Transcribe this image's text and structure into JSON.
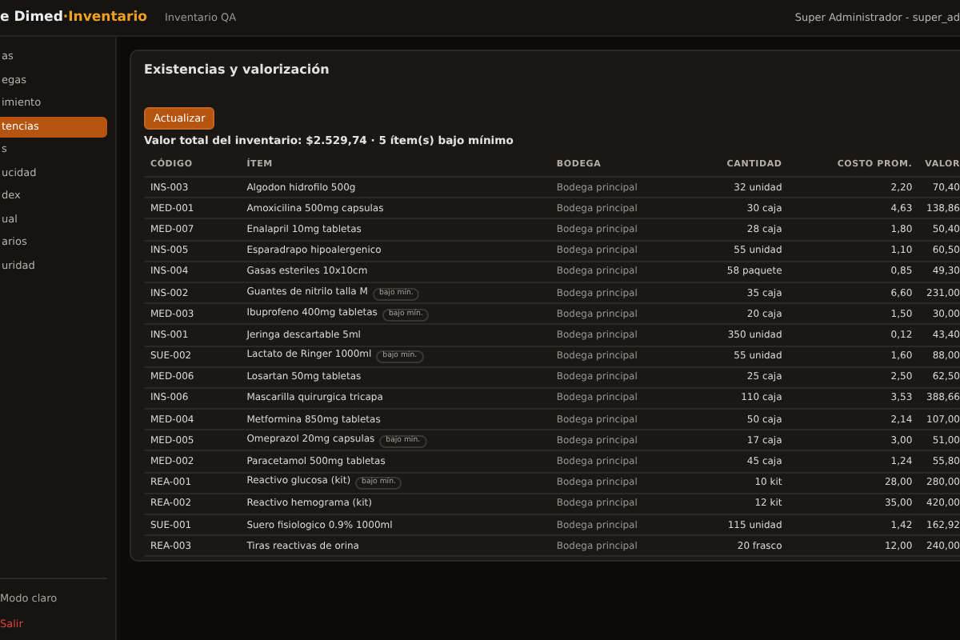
{
  "topbar": {
    "brand_lead": "e",
    "brand_name": "Dimed",
    "brand_accent": "·Inventario",
    "environment": "Inventario QA",
    "user": "Super Administrador - super_ad"
  },
  "sidebar": {
    "items": [
      {
        "label": "as",
        "selected": false
      },
      {
        "label": "egas",
        "selected": false
      },
      {
        "label": "imiento",
        "selected": false
      },
      {
        "label": "tencias",
        "selected": true
      },
      {
        "label": "s",
        "selected": false
      },
      {
        "label": "ucidad",
        "selected": false
      },
      {
        "label": "dex",
        "selected": false
      },
      {
        "label": "ual",
        "selected": false
      },
      {
        "label": "arios",
        "selected": false
      },
      {
        "label": "uridad",
        "selected": false
      }
    ],
    "theme_toggle": "Modo claro",
    "logout": "Salir"
  },
  "card": {
    "title": "Existencias y valorización",
    "refresh_button": "Actualizar",
    "summary": "Valor total del inventario: $2.529,74 · 5 ítem(s) bajo mínimo",
    "table": {
      "columns": [
        "CÓDIGO",
        "ÍTEM",
        "BODEGA",
        "CANTIDAD",
        "COSTO PROM.",
        "VALOR"
      ],
      "rows": [
        {
          "code": "INS-003",
          "item": "Algodon hidrofilo 500g",
          "warehouse": "Bodega principal",
          "quantity": "32 unidad",
          "avg_cost": "2,20",
          "value": "70,40"
        },
        {
          "code": "MED-001",
          "item": "Amoxicilina 500mg capsulas",
          "warehouse": "Bodega principal",
          "quantity": "30 caja",
          "avg_cost": "4,63",
          "value": "138,86"
        },
        {
          "code": "MED-007",
          "item": "Enalapril 10mg tabletas",
          "warehouse": "Bodega principal",
          "quantity": "28 caja",
          "avg_cost": "1,80",
          "value": "50,40"
        },
        {
          "code": "INS-005",
          "item": "Esparadrapo hipoalergenico",
          "warehouse": "Bodega principal",
          "quantity": "55 unidad",
          "avg_cost": "1,10",
          "value": "60,50"
        },
        {
          "code": "INS-004",
          "item": "Gasas esteriles 10x10cm",
          "warehouse": "Bodega principal",
          "quantity": "58 paquete",
          "avg_cost": "0,85",
          "value": "49,30"
        },
        {
          "code": "INS-002",
          "item": "Guantes de nitrilo talla M",
          "badge": "bajo mín.",
          "warehouse": "Bodega principal",
          "quantity": "35 caja",
          "avg_cost": "6,60",
          "value": "231,00"
        },
        {
          "code": "MED-003",
          "item": "Ibuprofeno 400mg tabletas",
          "badge": "bajo mín.",
          "warehouse": "Bodega principal",
          "quantity": "20 caja",
          "avg_cost": "1,50",
          "value": "30,00"
        },
        {
          "code": "INS-001",
          "item": "Jeringa descartable 5ml",
          "warehouse": "Bodega principal",
          "quantity": "350 unidad",
          "avg_cost": "0,12",
          "value": "43,40"
        },
        {
          "code": "SUE-002",
          "item": "Lactato de Ringer 1000ml",
          "badge": "bajo mín.",
          "warehouse": "Bodega principal",
          "quantity": "55 unidad",
          "avg_cost": "1,60",
          "value": "88,00"
        },
        {
          "code": "MED-006",
          "item": "Losartan 50mg tabletas",
          "warehouse": "Bodega principal",
          "quantity": "25 caja",
          "avg_cost": "2,50",
          "value": "62,50"
        },
        {
          "code": "INS-006",
          "item": "Mascarilla quirurgica tricapa",
          "warehouse": "Bodega principal",
          "quantity": "110 caja",
          "avg_cost": "3,53",
          "value": "388,66"
        },
        {
          "code": "MED-004",
          "item": "Metformina 850mg tabletas",
          "warehouse": "Bodega principal",
          "quantity": "50 caja",
          "avg_cost": "2,14",
          "value": "107,00"
        },
        {
          "code": "MED-005",
          "item": "Omeprazol 20mg capsulas",
          "badge": "bajo mín.",
          "warehouse": "Bodega principal",
          "quantity": "17 caja",
          "avg_cost": "3,00",
          "value": "51,00"
        },
        {
          "code": "MED-002",
          "item": "Paracetamol 500mg tabletas",
          "warehouse": "Bodega principal",
          "quantity": "45 caja",
          "avg_cost": "1,24",
          "value": "55,80"
        },
        {
          "code": "REA-001",
          "item": "Reactivo glucosa (kit)",
          "badge": "bajo mín.",
          "warehouse": "Bodega principal",
          "quantity": "10 kit",
          "avg_cost": "28,00",
          "value": "280,00"
        },
        {
          "code": "REA-002",
          "item": "Reactivo hemograma (kit)",
          "warehouse": "Bodega principal",
          "quantity": "12 kit",
          "avg_cost": "35,00",
          "value": "420,00"
        },
        {
          "code": "SUE-001",
          "item": "Suero fisiologico 0.9% 1000ml",
          "warehouse": "Bodega principal",
          "quantity": "115 unidad",
          "avg_cost": "1,42",
          "value": "162,92"
        },
        {
          "code": "REA-003",
          "item": "Tiras reactivas de orina",
          "warehouse": "Bodega principal",
          "quantity": "20 frasco",
          "avg_cost": "12,00",
          "value": "240,00"
        }
      ]
    }
  }
}
